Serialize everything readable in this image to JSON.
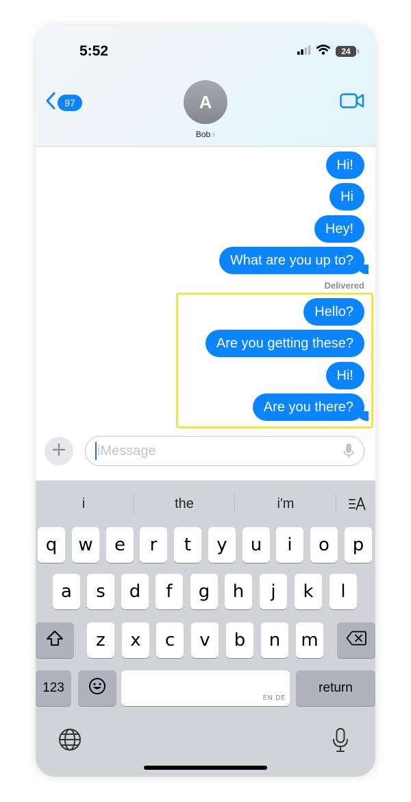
{
  "status_bar": {
    "time": "5:52",
    "battery": "24",
    "icons": [
      "signal-icon",
      "wifi-icon",
      "battery-icon"
    ]
  },
  "nav": {
    "back_count": "97",
    "avatar_initial": "A",
    "contact_name": "Bob",
    "icons": [
      "back-chevron-icon",
      "video-camera-icon"
    ]
  },
  "messages": [
    {
      "text": "Hi!"
    },
    {
      "text": "Hi"
    },
    {
      "text": "Hey!"
    },
    {
      "text": "What are you up to?"
    },
    {
      "text": "Hello?"
    },
    {
      "text": "Are you getting these?"
    },
    {
      "text": "Hi!"
    },
    {
      "text": "Are you there?"
    }
  ],
  "delivered_label": "Delivered",
  "input": {
    "placeholder": "iMessage"
  },
  "keyboard": {
    "suggestions": [
      "i",
      "the",
      "i'm"
    ],
    "row1": [
      "q",
      "w",
      "e",
      "r",
      "t",
      "y",
      "u",
      "i",
      "o",
      "p"
    ],
    "row2": [
      "a",
      "s",
      "d",
      "f",
      "g",
      "h",
      "j",
      "k",
      "l"
    ],
    "row3": [
      "z",
      "x",
      "c",
      "v",
      "b",
      "n",
      "m"
    ],
    "number_key": "123",
    "return_key": "return",
    "space_sub": "EN DE"
  },
  "colors": {
    "bubble": "#0a84ff",
    "highlight": "#f8e23e",
    "keyboard_bg": "#d1d3d9"
  }
}
